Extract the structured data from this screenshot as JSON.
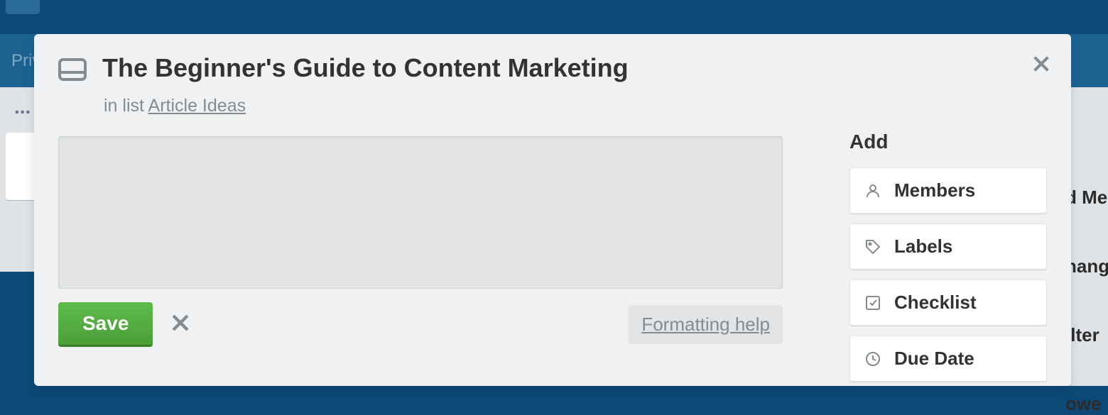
{
  "background": {
    "privacy_text": "Priv",
    "list_menu": "...",
    "right_menu": [
      "d Me",
      "hang",
      "ilter",
      "owe"
    ]
  },
  "card": {
    "title": "The Beginner's Guide to Content Marketing",
    "in_list_prefix": "in list ",
    "list_name": "Article Ideas",
    "description_value": "",
    "save_label": "Save",
    "formatting_help_label": "Formatting help"
  },
  "sidebar": {
    "heading": "Add",
    "buttons": {
      "members": "Members",
      "labels": "Labels",
      "checklist": "Checklist",
      "due_date": "Due Date"
    }
  }
}
